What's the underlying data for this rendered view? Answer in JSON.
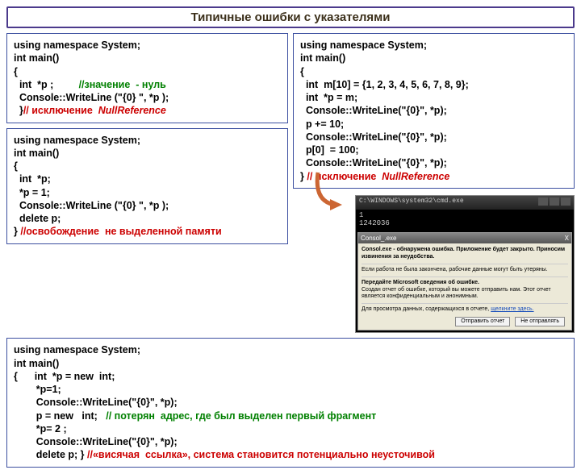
{
  "title": "Типичные ошибки с указателями",
  "box1": {
    "l1": "using namespace System;",
    "l2": "int main()",
    "l3": "{",
    "l4a": "  int  *p ;         ",
    "l4b": "//значение  - нуль",
    "l5": "  Console::WriteLine (\"{0} \", *p );",
    "l6a": "  }",
    "l6b": "// исключение  ",
    "l6c": "NullReference"
  },
  "box2": {
    "l1": "using namespace System;",
    "l2": "int main()",
    "l3": "{",
    "l4": "  int  *p;",
    "l5": "  *p = 1;",
    "l6": "  Console::WriteLine (\"{0} \", *p );",
    "l7": "  delete p;",
    "l8a": "} ",
    "l8b": "//освобождение  не выделенной памяти"
  },
  "box3": {
    "l1": "using namespace System;",
    "l2": "int main()",
    "l3": "{",
    "l4": "  int  m[10] = {1, 2, 3, 4, 5, 6, 7, 8, 9};",
    "l5": "  int  *p = m;",
    "l6": "  Console::WriteLine(\"{0}\", *p);",
    "l7": "  p += 10;",
    "l8": "  Console::WriteLine(\"{0}\", *p);",
    "l9": "  p[0]  = 100;",
    "l10": "  Console::WriteLine(\"{0}\", *p);",
    "l11a": "} ",
    "l11b": "// исключение  ",
    "l11c": "NullReference"
  },
  "box4": {
    "l1": "using namespace System;",
    "l2": "int main()",
    "l3": "{      int  *p = new  int;",
    "l4": "        *p=1;",
    "l5": "        Console::WriteLine(\"{0}\", *p);",
    "l6a": "        p = new   int;   ",
    "l6b": "// потерян  адрес, где был выделен первый фрагмент",
    "l7": "        *p= 2 ;",
    "l8": "        Console::WriteLine(\"{0}\", *p);",
    "l9a": "        delete p; } ",
    "l9b": "//«висячая  ссылка», система становится потенциально неусточивой"
  },
  "screenshot": {
    "title": "C:\\WINDOWS\\system32\\cmd.exe",
    "line1": "1",
    "line2": "1242036",
    "dlg_title": "Consol_.exe",
    "dlg_close": "X",
    "dlg_head": "Consol.exe - обнаружена ошибка. Приложение будет закрыто. Приносим извинения за неудобства.",
    "dlg_p1": "Если работа не была закончена, рабочие данные могут быть утеряны.",
    "dlg_p2h": "Передайте Microsoft сведения об ошибке.",
    "dlg_p2": "Создан отчет об ошибке, который вы можете отправить нам. Этот отчет является конфиденциальным и анонимным.",
    "dlg_p3a": "Для просмотра данных, содержащихся в отчете,  ",
    "dlg_p3b": "щелкните здесь.",
    "btn1": "Отправить отчет",
    "btn2": "Не отправлять"
  }
}
